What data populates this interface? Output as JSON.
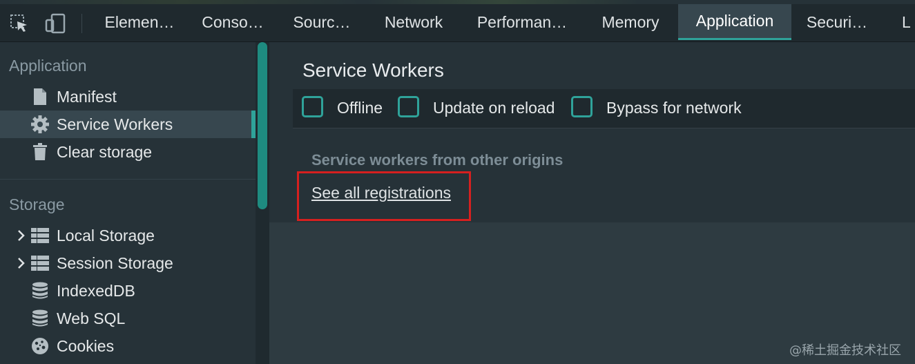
{
  "tabs": [
    {
      "label": "Elemen…",
      "active": false
    },
    {
      "label": "Conso…",
      "active": false
    },
    {
      "label": "Sourc…",
      "active": false
    },
    {
      "label": "Network",
      "active": false
    },
    {
      "label": "Performan…",
      "active": false
    },
    {
      "label": "Memory",
      "active": false
    },
    {
      "label": "Application",
      "active": true
    },
    {
      "label": "Securi…",
      "active": false
    },
    {
      "label": "L",
      "active": false
    }
  ],
  "toolbar_icons": [
    "inspect-element-icon",
    "device-toolbar-icon"
  ],
  "sidebar": {
    "application_title": "Application",
    "application_items": [
      {
        "label": "Manifest",
        "icon": "document-icon"
      },
      {
        "label": "Service Workers",
        "icon": "gear-icon",
        "selected": true
      },
      {
        "label": "Clear storage",
        "icon": "trash-icon"
      }
    ],
    "storage_title": "Storage",
    "storage_items": [
      {
        "label": "Local Storage",
        "icon": "grid-icon",
        "expandable": true
      },
      {
        "label": "Session Storage",
        "icon": "grid-icon",
        "expandable": true
      },
      {
        "label": "IndexedDB",
        "icon": "database-icon"
      },
      {
        "label": "Web SQL",
        "icon": "database-icon"
      },
      {
        "label": "Cookies",
        "icon": "cookie-icon"
      }
    ]
  },
  "main": {
    "title": "Service Workers",
    "checkboxes": [
      {
        "label": "Offline",
        "checked": false
      },
      {
        "label": "Update on reload",
        "checked": false
      },
      {
        "label": "Bypass for network",
        "checked": false
      }
    ],
    "other_origins_heading": "Service workers from other origins",
    "registrations_link": "See all registrations"
  },
  "watermark": "@稀土掘金技术社区",
  "colors": {
    "accent": "#2fa39a",
    "highlight": "#d6201f",
    "background": "#263238"
  }
}
